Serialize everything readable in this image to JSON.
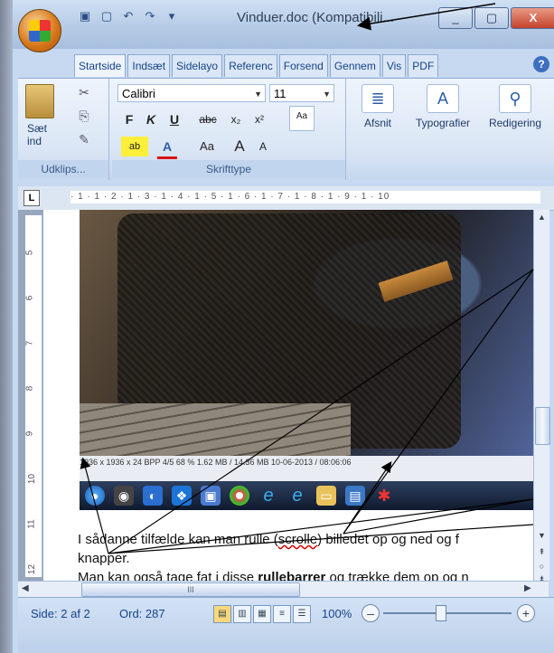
{
  "window": {
    "title": "Vinduer.doc (Kompatibili...",
    "caption": {
      "minimize": "_",
      "maximize": "▢",
      "close": "X"
    }
  },
  "qat": {
    "save": "▣",
    "new": "▢",
    "undo": "↶",
    "redo": "↷",
    "more": "▾"
  },
  "tabs": [
    "Startside",
    "Indsæt",
    "Sidelayo",
    "Referenc",
    "Forsend",
    "Gennem",
    "Vis",
    "PDF"
  ],
  "ribbon": {
    "clipboard": {
      "paste": "Sæt ind",
      "label": "Udklips..."
    },
    "font": {
      "name": "Calibri",
      "size": "11",
      "bold": "F",
      "italic": "K",
      "underline": "U",
      "strike": "abc",
      "subscript": "x₂",
      "superscript": "x²",
      "case": "Aa",
      "grow": "A",
      "shrink": "A",
      "label": "Skrifttype"
    },
    "paragraph": {
      "label": "Afsnit"
    },
    "styles": {
      "label": "Typografier"
    },
    "editing": {
      "label": "Redigering"
    }
  },
  "ruler": {
    "corner": "L",
    "h": "· 1 · 1 · 2 · 1 · 3 · 1 · 4 · 1 · 5 · 1 · 6 · 1 · 7 · 1 · 8 · 1 · 9 · 1 · 10",
    "v": [
      "5",
      "6",
      "7",
      "8",
      "9",
      "10",
      "11",
      "12"
    ]
  },
  "screenshot_status": "1936 x 1936 x 24 BPP   4/5   68 %   1.62 MB / 14.36 MB   10-06-2013 / 08:06:06",
  "doc": {
    "line1_pre": "I sådanne tilfælde kan man rulle (",
    "line1_scroll": "scrolle",
    "line1_post": ") billedet op og ned og f",
    "line2": "knapper.",
    "line3_pre": "Man kan også tage fat i disse ",
    "line3_bold": "rullebarrer",
    "line3_post": " og trække dem op og n"
  },
  "hscroll_grip": "III",
  "statusbar": {
    "page": "Side: 2 af 2",
    "words": "Ord: 287",
    "zoom": "100%",
    "zoom_minus": "–",
    "zoom_plus": "+"
  }
}
